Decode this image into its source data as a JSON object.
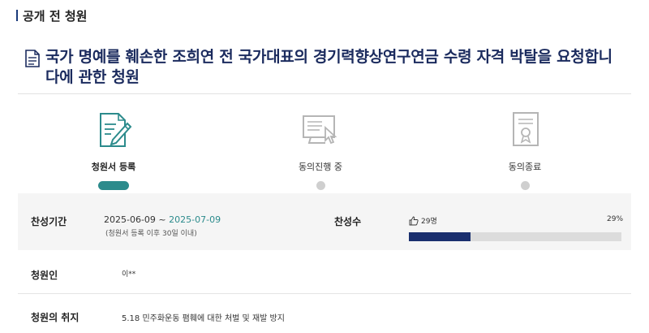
{
  "section": {
    "title": "공개 전 청원"
  },
  "petition": {
    "title": "국가 명예를 훼손한 조희연 전 국가대표의 경기력향상연구연금 수령 자격 박탈을 요청합니다에 관한 청원"
  },
  "steps": [
    {
      "label": "청원서 등록",
      "active": true,
      "icon": "pen-document-icon"
    },
    {
      "label": "동의진행 중",
      "active": false,
      "icon": "computer-click-icon"
    },
    {
      "label": "동의종료",
      "active": false,
      "icon": "certificate-icon"
    }
  ],
  "info": {
    "period_label": "찬성기간",
    "period_start": "2025-06-09",
    "period_separator": " ~ ",
    "period_end": "2025-07-09",
    "period_note": "(청원서 등록 이후 30일 이내)",
    "support_label": "찬성수",
    "support_count": "29명",
    "support_percent": "29%",
    "support_fraction": 0.29,
    "petitioner_label": "청원인",
    "petitioner_value": "이**",
    "purpose_label": "청원의 취지",
    "purpose_value": "5.18 민주화운동 폄훼에 대한 처벌 및 재발 방지"
  },
  "colors": {
    "accent": "#2c8b8c",
    "navy": "#1a2f6e",
    "title": "#1b2b5e"
  }
}
